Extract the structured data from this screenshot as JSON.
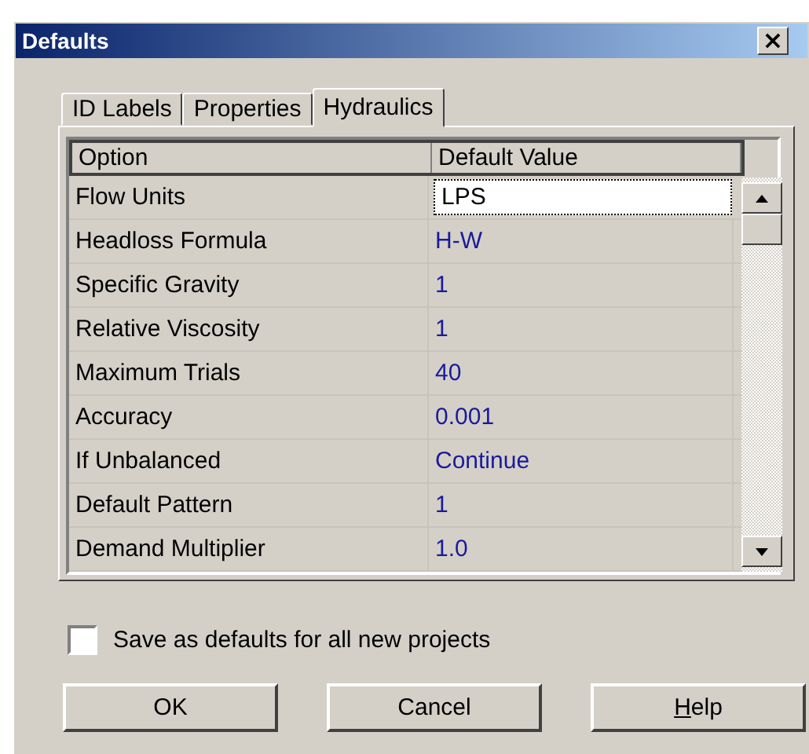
{
  "window": {
    "title": "Defaults",
    "close": "×"
  },
  "tabs": [
    {
      "label": "ID Labels",
      "selected": false
    },
    {
      "label": "Properties",
      "selected": false
    },
    {
      "label": "Hydraulics",
      "selected": true
    }
  ],
  "table": {
    "columns": [
      "Option",
      "Default Value"
    ],
    "rows": [
      {
        "option": "Flow Units",
        "value": "LPS",
        "selected": true
      },
      {
        "option": "Headloss Formula",
        "value": "H-W",
        "selected": false
      },
      {
        "option": "Specific Gravity",
        "value": "1",
        "selected": false
      },
      {
        "option": "Relative Viscosity",
        "value": "1",
        "selected": false
      },
      {
        "option": "Maximum Trials",
        "value": "40",
        "selected": false
      },
      {
        "option": "Accuracy",
        "value": "0.001",
        "selected": false
      },
      {
        "option": "If Unbalanced",
        "value": "Continue",
        "selected": false
      },
      {
        "option": "Default Pattern",
        "value": "1",
        "selected": false
      },
      {
        "option": "Demand Multiplier",
        "value": "1.0",
        "selected": false
      }
    ]
  },
  "save_defaults": {
    "label": "Save as defaults for all new projects",
    "checked": false
  },
  "buttons": [
    {
      "label": "OK",
      "mnemonic": false
    },
    {
      "label": "Cancel",
      "mnemonic": false
    },
    {
      "label": "Help",
      "mnemonic": true
    }
  ]
}
